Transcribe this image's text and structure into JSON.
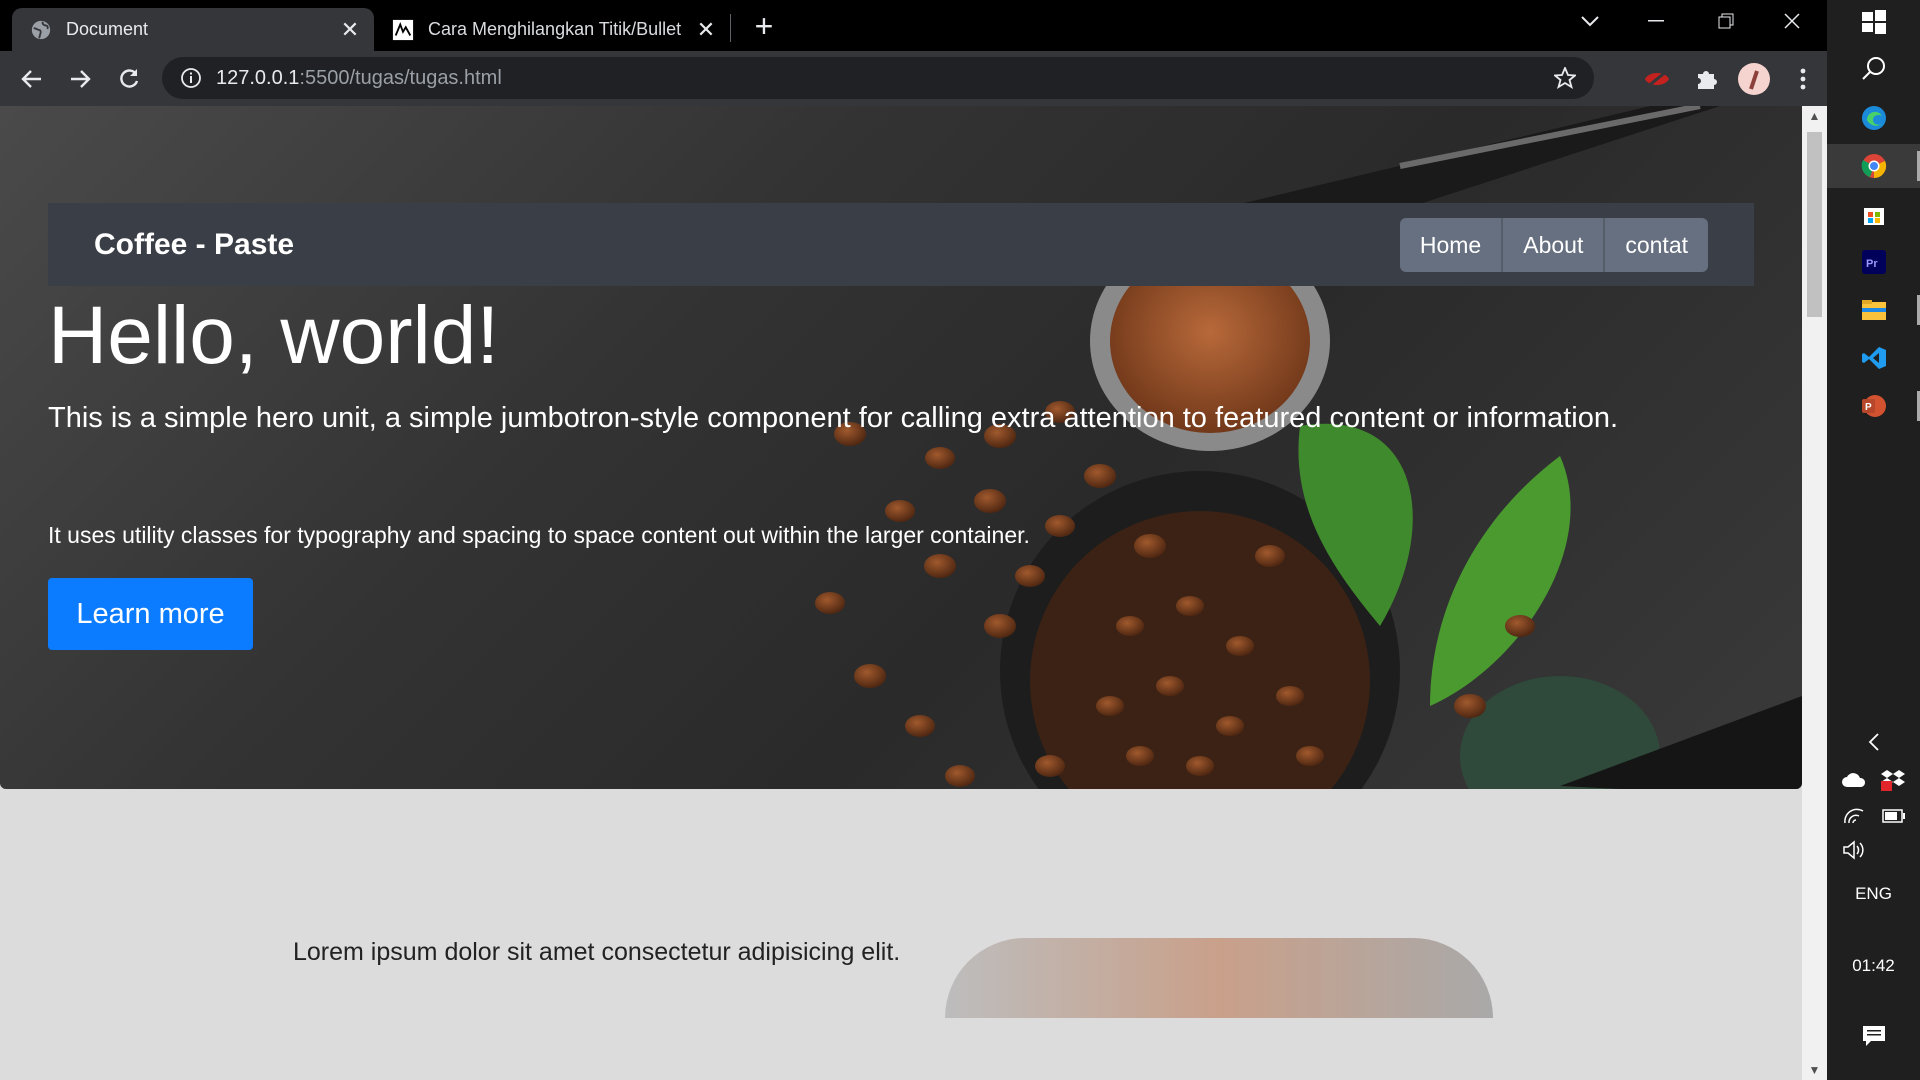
{
  "browser": {
    "tabs": [
      {
        "title": "Document",
        "active": true
      },
      {
        "title": "Cara Menghilangkan Titik/Bullet",
        "active": false
      }
    ],
    "address": {
      "host": "127.0.0.1",
      "rest": ":5500/tugas/tugas.html"
    }
  },
  "page": {
    "navbar": {
      "brand": "Coffee - Paste",
      "links": [
        "Home",
        "About",
        "contat"
      ]
    },
    "hero": {
      "title": "Hello, world!",
      "lead": "This is a simple hero unit, a simple jumbotron-style component for calling extra attention to featured content or information.",
      "text": "It uses utility classes for typography and spacing to space content out within the larger container.",
      "button": "Learn more"
    },
    "section": {
      "text": "Lorem ipsum dolor sit amet consectetur adipisicing elit."
    }
  },
  "taskbar": {
    "language": "ENG",
    "time": "01:42"
  },
  "colors": {
    "primary_button": "#0b7bff",
    "navbar": "#3a3e46",
    "nav_link": "#667080",
    "page_bg": "#dcdcdc"
  }
}
